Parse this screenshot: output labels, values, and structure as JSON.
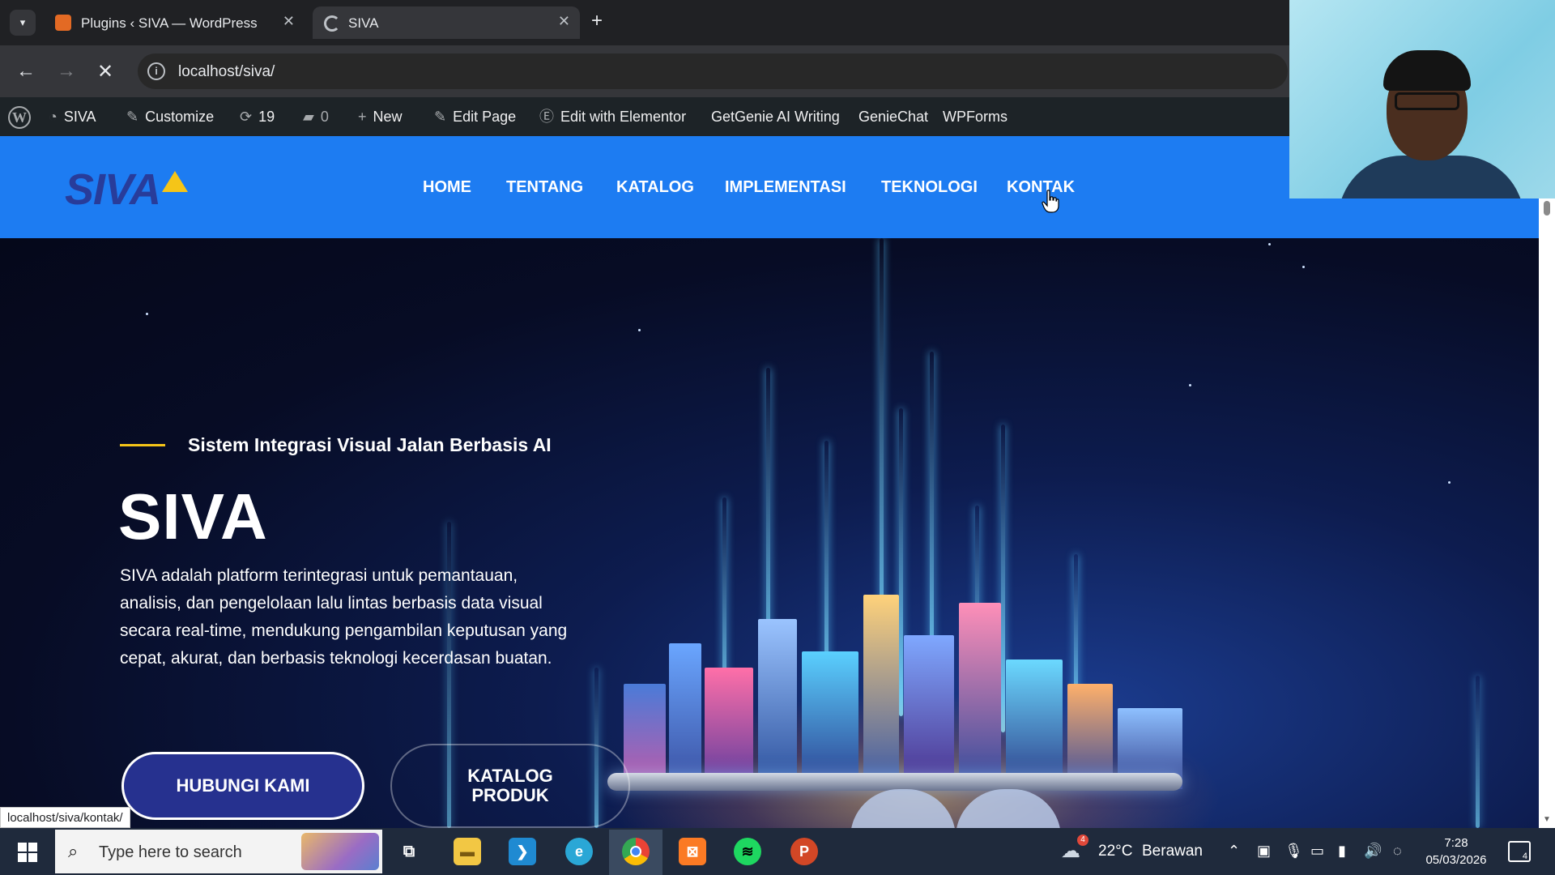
{
  "browser": {
    "tabs": [
      {
        "title": "Plugins ‹ SIVA — WordPress",
        "favicon_color": "#e36a24",
        "active": false
      },
      {
        "title": "SIVA",
        "active": true,
        "loading": true
      }
    ],
    "url": "localhost/siva/",
    "status_url": "localhost/siva/kontak/"
  },
  "admin_bar": {
    "site_name": "SIVA",
    "customize": "Customize",
    "updates_count": "19",
    "comments_count": "0",
    "new": "New",
    "edit_page": "Edit Page",
    "edit_elementor": "Edit with Elementor",
    "getgenie": "GetGenie AI Writing",
    "geniechat": "GenieChat",
    "wpforms": "WPForms"
  },
  "site": {
    "logo_text": "SIVA",
    "menu": [
      "HOME",
      "TENTANG",
      "KATALOG",
      "IMPLEMENTASI",
      "TEKNOLOGI",
      "KONTAK"
    ],
    "header_color": "#1d7cf2"
  },
  "hero": {
    "tagline": "Sistem Integrasi Visual Jalan Berbasis AI",
    "title": "SIVA",
    "description": "SIVA adalah platform terintegrasi untuk pemantauan, analisis, dan pengelolaan lalu lintas berbasis data visual secara real-time, mendukung pengambilan keputusan yang cepat, akurat, dan berbasis teknologi kecerdasan buatan.",
    "primary_button": "HUBUNGI KAMI",
    "secondary_button_line1": "KATALOG",
    "secondary_button_line2": "PRODUK"
  },
  "taskbar": {
    "search_placeholder": "Type here to search",
    "apps": [
      "task-view",
      "file-explorer",
      "vscode",
      "edge",
      "chrome",
      "xampp",
      "spotify",
      "powerpoint"
    ],
    "weather_temp": "22°C",
    "weather_text": "Berawan",
    "weather_badge": "4",
    "time": "7:28",
    "date": "05/03/2026",
    "notification_count": "4"
  }
}
